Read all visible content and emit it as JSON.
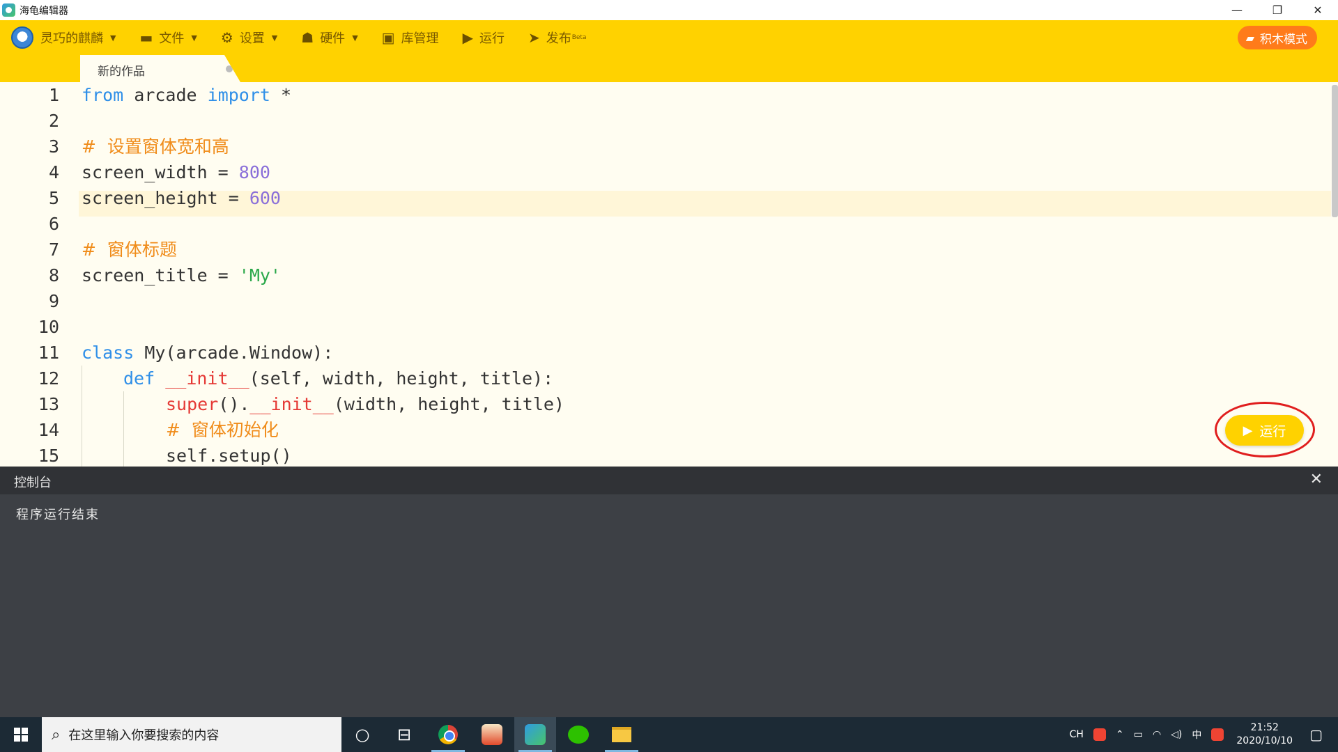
{
  "window": {
    "title": "海龟编辑器",
    "minimize": "—",
    "restore": "❐",
    "close": "✕"
  },
  "toolbar": {
    "user": "灵巧的麒麟",
    "file": "文件",
    "settings": "设置",
    "hardware": "硬件",
    "library": "库管理",
    "run": "运行",
    "publish": "发布",
    "publish_badge": "Beta",
    "block_mode": "积木模式"
  },
  "tabs": [
    {
      "label": "新的作品"
    }
  ],
  "editor": {
    "line_numbers": [
      "1",
      "2",
      "3",
      "4",
      "5",
      "6",
      "7",
      "8",
      "9",
      "10",
      "11",
      "12",
      "13",
      "14",
      "15"
    ],
    "lines": {
      "l1_kw1": "from",
      "l1_mid": " arcade ",
      "l1_kw2": "import",
      "l1_end": " *",
      "l3": "#  设置窗体宽和高",
      "l4_a": "screen_width = ",
      "l4_num": "800",
      "l5_a": "screen_height = ",
      "l5_num": "600",
      "l7": "#  窗体标题",
      "l8_a": "screen_title = ",
      "l8_str": "'My'",
      "l11_kw": "class",
      "l11_rest": " My(arcade.Window):",
      "l12_kw": "def",
      "l12_sp": " ",
      "l12_fn": "__init__",
      "l12_rest": "(self, width, height, title):",
      "l13_fn1": "super",
      "l13_mid": "().",
      "l13_fn2": "__init__",
      "l13_rest": "(width, height, title)",
      "l14": "#  窗体初始化",
      "l15": "self.setup()"
    },
    "run_button": "运行"
  },
  "console": {
    "title": "控制台",
    "close": "✕",
    "output": "程序运行结束"
  },
  "taskbar": {
    "search_placeholder": "在这里输入你要搜索的内容",
    "lang": "CH",
    "ime": "中",
    "time": "21:52",
    "date": "2020/10/10"
  }
}
